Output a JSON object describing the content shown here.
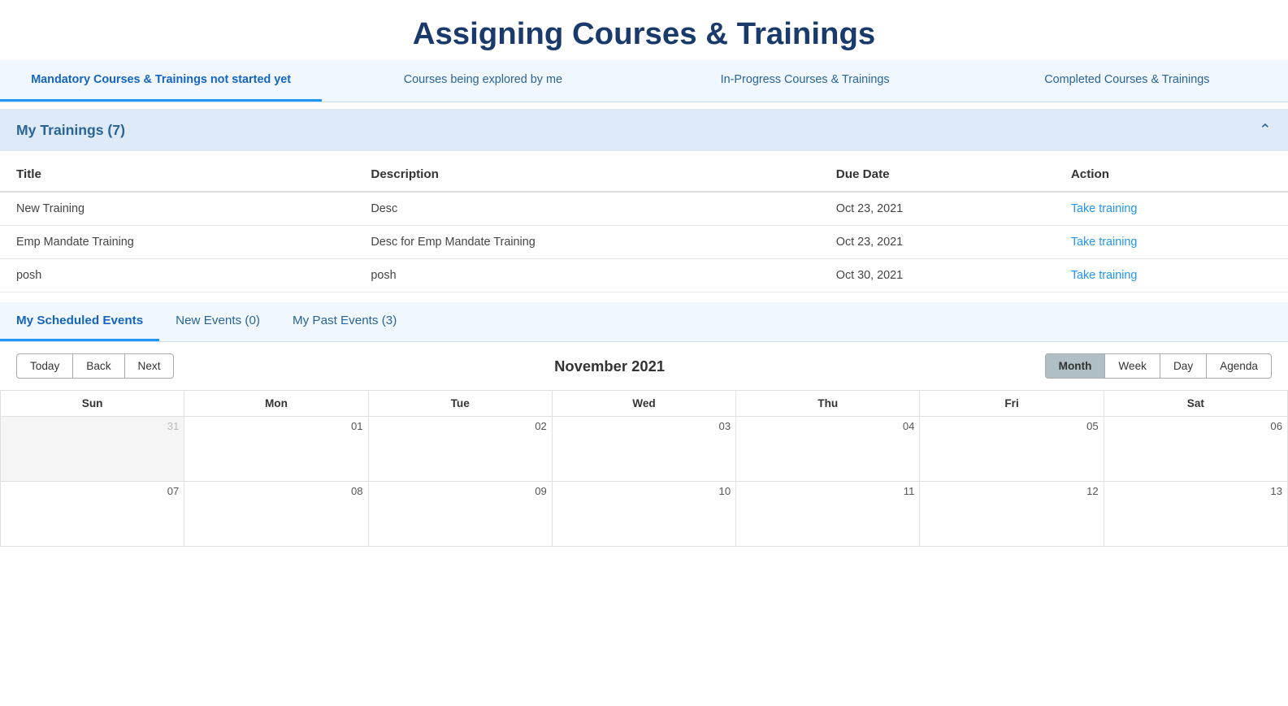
{
  "page": {
    "title": "Assigning Courses & Trainings"
  },
  "top_tabs": [
    {
      "id": "mandatory",
      "label": "Mandatory Courses & Trainings not started yet",
      "active": true
    },
    {
      "id": "exploring",
      "label": "Courses being explored by me",
      "active": false
    },
    {
      "id": "inprogress",
      "label": "In-Progress Courses & Trainings",
      "active": false
    },
    {
      "id": "completed",
      "label": "Completed Courses & Trainings",
      "active": false
    }
  ],
  "trainings_section": {
    "title": "My Trainings (7)",
    "columns": [
      "Title",
      "Description",
      "Due Date",
      "Action"
    ],
    "rows": [
      {
        "title": "New Training",
        "description": "Desc",
        "due_date": "Oct 23, 2021",
        "action": "Take training"
      },
      {
        "title": "Emp Mandate Training",
        "description": "Desc for Emp Mandate Training",
        "due_date": "Oct 23, 2021",
        "action": "Take training"
      },
      {
        "title": "posh",
        "description": "posh",
        "due_date": "Oct 30, 2021",
        "action": "Take training"
      }
    ]
  },
  "events_tabs": [
    {
      "id": "scheduled",
      "label": "My Scheduled Events",
      "active": true
    },
    {
      "id": "new",
      "label": "New Events (0)",
      "active": false
    },
    {
      "id": "past",
      "label": "My Past Events (3)",
      "active": false
    }
  ],
  "calendar": {
    "nav_buttons": [
      "Today",
      "Back",
      "Next"
    ],
    "month_title": "November 2021",
    "view_buttons": [
      "Month",
      "Week",
      "Day",
      "Agenda"
    ],
    "active_view": "Month",
    "days_of_week": [
      "Sun",
      "Mon",
      "Tue",
      "Wed",
      "Thu",
      "Fri",
      "Sat"
    ],
    "weeks": [
      [
        {
          "day": "31",
          "other": true
        },
        {
          "day": "01",
          "other": false
        },
        {
          "day": "02",
          "other": false
        },
        {
          "day": "03",
          "other": false
        },
        {
          "day": "04",
          "other": false
        },
        {
          "day": "05",
          "other": false
        },
        {
          "day": "06",
          "other": false
        }
      ],
      [
        {
          "day": "07",
          "other": false
        },
        {
          "day": "08",
          "other": false
        },
        {
          "day": "09",
          "other": false
        },
        {
          "day": "10",
          "other": false
        },
        {
          "day": "11",
          "other": false
        },
        {
          "day": "12",
          "other": false
        },
        {
          "day": "13",
          "other": false
        }
      ]
    ]
  }
}
